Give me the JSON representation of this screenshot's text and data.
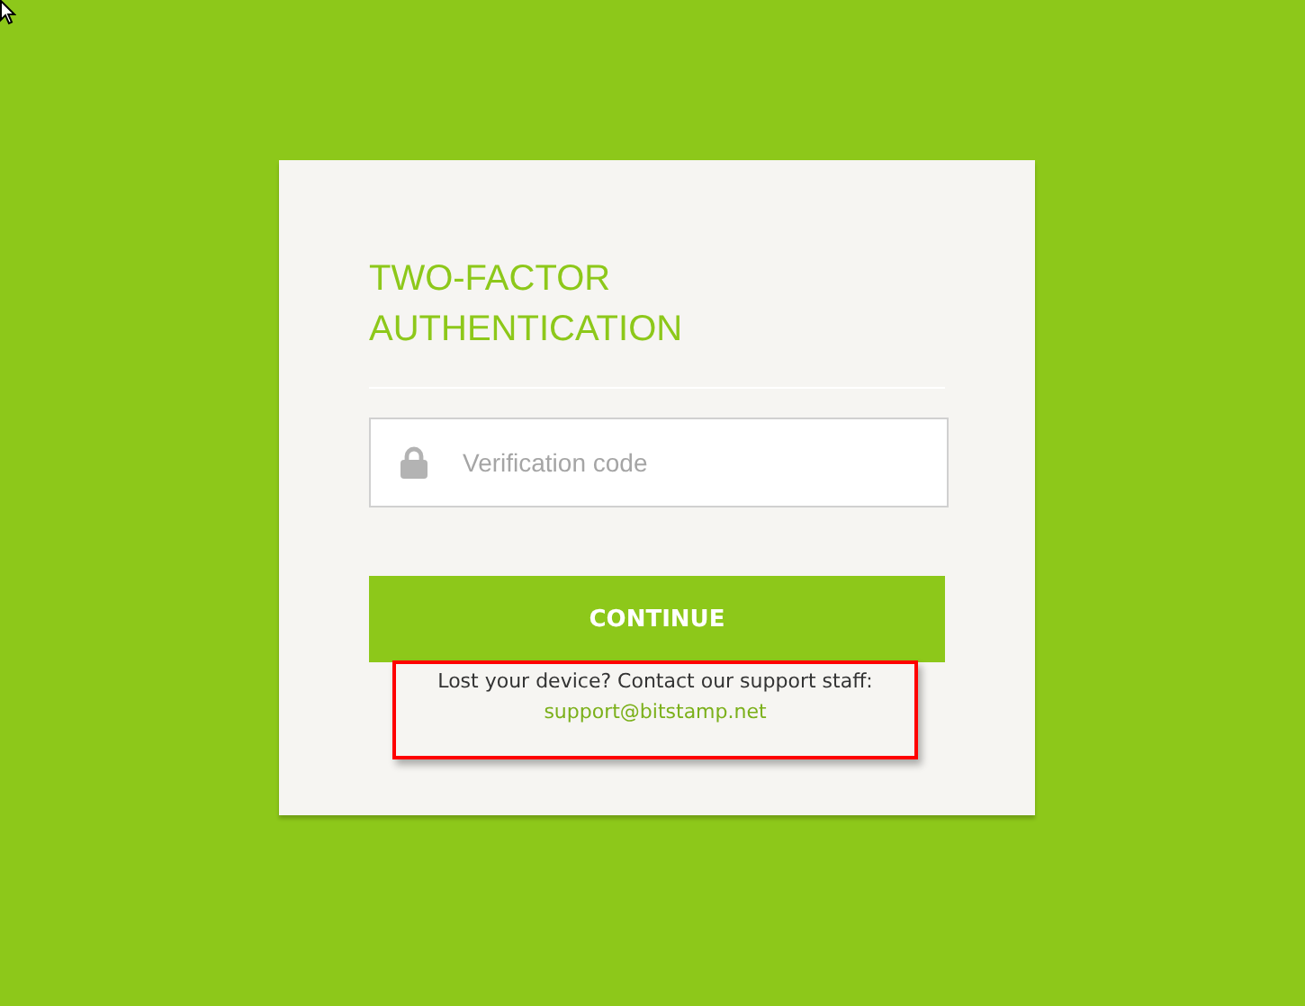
{
  "title": "TWO-FACTOR AUTHENTICATION",
  "code_field": {
    "placeholder": "Verification code"
  },
  "continue_button": "CONTINUE",
  "help_text": "Lost your device? Contact our support staff:",
  "support_link": "support@bitstamp.net"
}
